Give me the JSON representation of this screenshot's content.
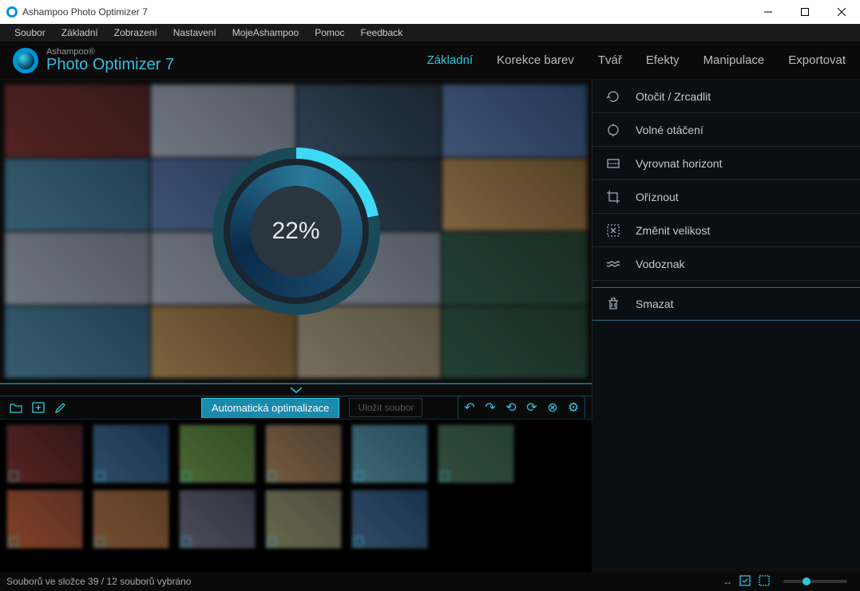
{
  "window": {
    "title": "Ashampoo Photo Optimizer 7"
  },
  "menu": {
    "items": [
      "Soubor",
      "Základní",
      "Zobrazení",
      "Nastavení",
      "MojeAshampoo",
      "Pomoc",
      "Feedback"
    ]
  },
  "brand": {
    "top": "Ashampoo®",
    "bottom": "Photo Optimizer 7"
  },
  "tabs": {
    "items": [
      {
        "label": "Základní",
        "active": true
      },
      {
        "label": "Korekce barev",
        "active": false
      },
      {
        "label": "Tvář",
        "active": false
      },
      {
        "label": "Efekty",
        "active": false
      },
      {
        "label": "Manipulace",
        "active": false
      },
      {
        "label": "Exportovat",
        "active": false
      }
    ]
  },
  "progress": {
    "percent": "22%",
    "value": 22
  },
  "toolbar": {
    "auto_optimize": "Automatická optimalizace",
    "save": "Uložit soubor"
  },
  "panel": {
    "items": [
      {
        "icon": "rotate-icon",
        "label": "Otočit / Zrcadlit"
      },
      {
        "icon": "free-rotate-icon",
        "label": "Volné otáčení"
      },
      {
        "icon": "horizon-icon",
        "label": "Vyrovnat horizont"
      },
      {
        "icon": "crop-icon",
        "label": "Oříznout"
      },
      {
        "icon": "resize-icon",
        "label": "Změnit velikost"
      },
      {
        "icon": "watermark-icon",
        "label": "Vodoznak"
      },
      {
        "icon": "delete-icon",
        "label": "Smazat",
        "highlight": true
      }
    ]
  },
  "status": {
    "text": "Souborů ve složce 39 / 12 souborů vybráno"
  }
}
